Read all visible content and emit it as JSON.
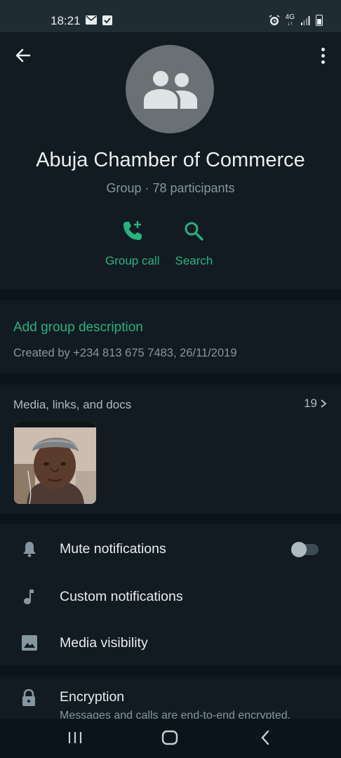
{
  "status_bar": {
    "time": "18:21",
    "network": "4G"
  },
  "header": {
    "group_name": "Abuja Chamber of Commerce",
    "meta": "Group · 78 participants",
    "actions": [
      {
        "label": "Group call",
        "icon": "add-call-icon"
      },
      {
        "label": "Search",
        "icon": "search-icon"
      }
    ]
  },
  "description": {
    "add_label": "Add group description",
    "created": "Created by +234 813 675 7483, 26/11/2019"
  },
  "media": {
    "title": "Media, links, and docs",
    "count": "19"
  },
  "settings": {
    "items": [
      {
        "label": "Mute notifications",
        "icon": "bell-icon",
        "toggle": false
      },
      {
        "label": "Custom notifications",
        "icon": "music-note-icon"
      },
      {
        "label": "Media visibility",
        "icon": "image-icon"
      }
    ]
  },
  "encryption": {
    "title": "Encryption",
    "subtitle": "Messages and calls are end-to-end encrypted."
  },
  "colors": {
    "accent": "#25b37e",
    "background": "#0b141a",
    "surface": "#111b21"
  }
}
